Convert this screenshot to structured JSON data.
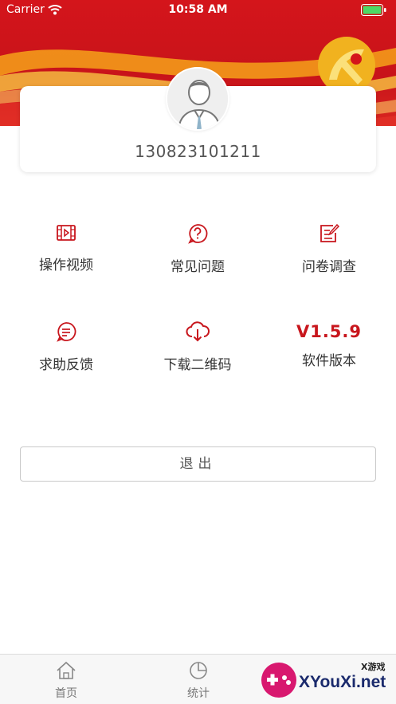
{
  "status_bar": {
    "carrier": "Carrier",
    "time": "10:58 AM"
  },
  "profile": {
    "phone": "130823101211"
  },
  "menu": {
    "items": [
      {
        "label": "操作视频",
        "icon": "video-icon"
      },
      {
        "label": "常见问题",
        "icon": "question-icon"
      },
      {
        "label": "问卷调查",
        "icon": "survey-icon"
      },
      {
        "label": "求助反馈",
        "icon": "feedback-icon"
      },
      {
        "label": "下载二维码",
        "icon": "cloud-download-icon"
      },
      {
        "label": "软件版本",
        "value": "V1.5.9"
      }
    ]
  },
  "logout": {
    "label": "退出"
  },
  "tabbar": {
    "tabs": [
      {
        "label": "首页",
        "icon": "home-icon"
      },
      {
        "label": "统计",
        "icon": "pie-chart-icon"
      }
    ]
  },
  "watermark": {
    "text": "XYouXi.net",
    "small": "X游戏"
  },
  "colors": {
    "accent": "#c8161d",
    "banner": "#d4151b"
  }
}
